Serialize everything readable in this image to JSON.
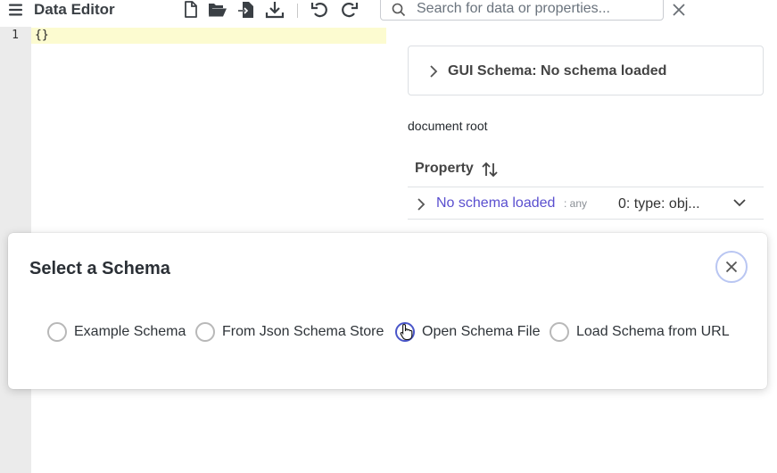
{
  "toolbar": {
    "title": "Data Editor",
    "icons": [
      "menu-icon",
      "new-file-icon",
      "open-folder-icon",
      "import-icon",
      "download-icon",
      "undo-icon",
      "redo-icon"
    ],
    "search": {
      "placeholder": "Search for data or properties...",
      "value": ""
    },
    "clear_icon": "close-icon"
  },
  "editor": {
    "line_numbers": [
      "1"
    ],
    "lines": [
      "{}"
    ],
    "active_line_color": "#fcfbd0"
  },
  "gui_schema": {
    "title": "GUI Schema: No schema loaded"
  },
  "document": {
    "root_label": "document root",
    "property_header": "Property",
    "rows": [
      {
        "name": "No schema loaded",
        "type": ": any",
        "value": "0: type: obj..."
      }
    ]
  },
  "modal": {
    "title": "Select a Schema",
    "options": [
      {
        "label": "Example Schema",
        "selected": false
      },
      {
        "label": "From Json Schema Store",
        "selected": false
      },
      {
        "label": "Open Schema File",
        "selected": false,
        "hovered": true
      },
      {
        "label": "Load Schema from URL",
        "selected": false
      }
    ]
  },
  "colors": {
    "link": "#5a4fcf",
    "gutter": "#ebebeb",
    "close_ring": "#b9c6f2",
    "radio_hover": "#4a56c9"
  }
}
